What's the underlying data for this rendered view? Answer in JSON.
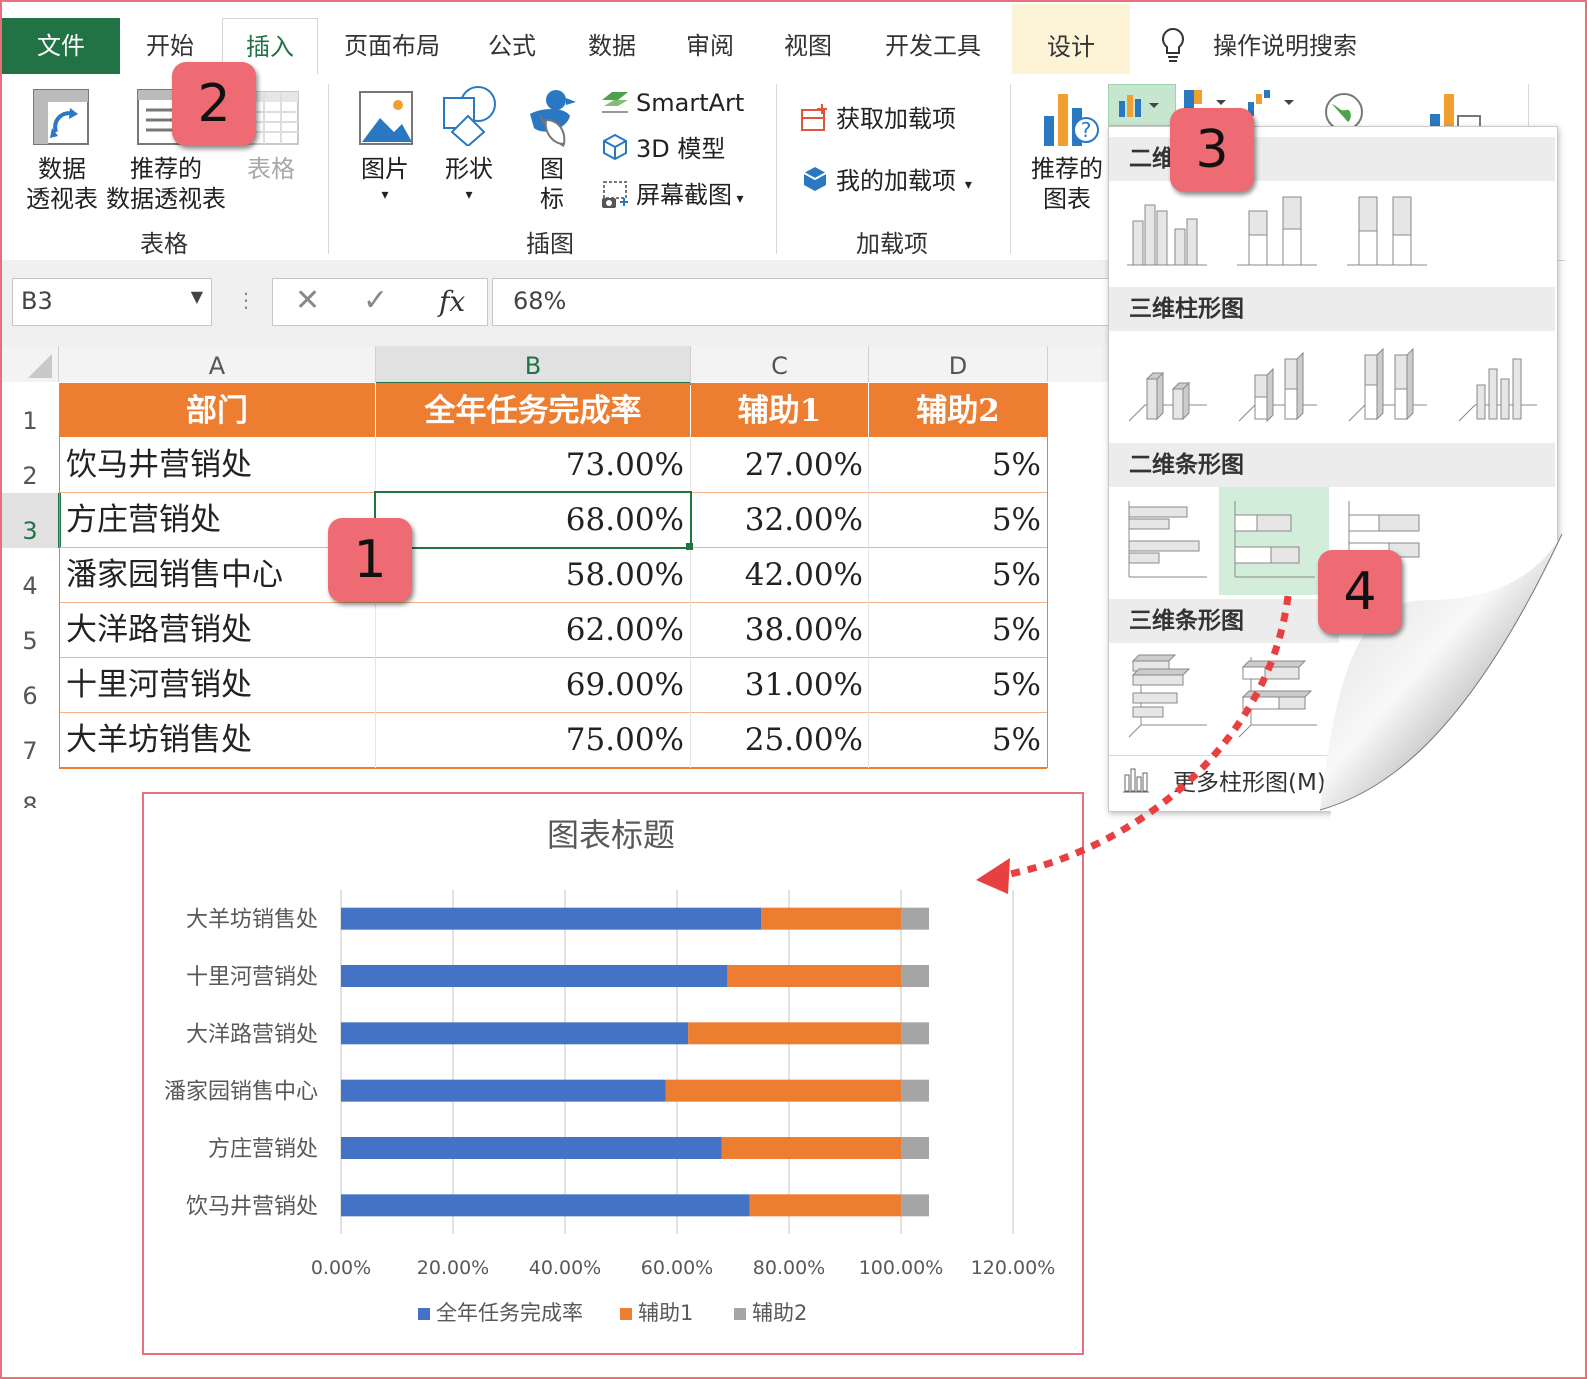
{
  "tabs": [
    {
      "label": "文件",
      "kind": "file"
    },
    {
      "label": "开始"
    },
    {
      "label": "插入",
      "kind": "active"
    },
    {
      "label": "页面布局"
    },
    {
      "label": "公式"
    },
    {
      "label": "数据"
    },
    {
      "label": "审阅"
    },
    {
      "label": "视图"
    },
    {
      "label": "开发工具"
    },
    {
      "label": "设计",
      "kind": "design"
    }
  ],
  "tell_me": "操作说明搜索",
  "ribbon": {
    "pivot_l1": "数据",
    "pivot_l2": "透视表",
    "rec_pivot_l1": "推荐的",
    "rec_pivot_l2": "数据透视表",
    "table": "表格",
    "group_table": "表格",
    "picture": "图片",
    "shapes": "形状",
    "icons_l1": "图",
    "icons_l2": "标",
    "smartart": "SmartArt",
    "model3d": "3D 模型",
    "screenshot": "屏幕截图",
    "group_illustrations": "插图",
    "get_addins": "获取加载项",
    "my_addins": "我的加载项",
    "group_addins": "加载项",
    "rec_chart_l1": "推荐的",
    "rec_chart_l2": "图表"
  },
  "formula_bar": {
    "name_box": "B3",
    "value": "68%",
    "fx": "fx"
  },
  "columns": [
    "A",
    "B",
    "C",
    "D"
  ],
  "rows": [
    "1",
    "2",
    "3",
    "4",
    "5",
    "6",
    "7",
    "8"
  ],
  "table": {
    "headers": [
      "部门",
      "全年任务完成率",
      "辅助1",
      "辅助2"
    ],
    "data": [
      [
        "饮马井营销处",
        "73.00%",
        "27.00%",
        "5%"
      ],
      [
        "方庄营销处",
        "68.00%",
        "32.00%",
        "5%"
      ],
      [
        "潘家园销售中心",
        "58.00%",
        "42.00%",
        "5%"
      ],
      [
        "大洋路营销处",
        "62.00%",
        "38.00%",
        "5%"
      ],
      [
        "十里河营销处",
        "69.00%",
        "31.00%",
        "5%"
      ],
      [
        "大羊坊销售处",
        "75.00%",
        "25.00%",
        "5%"
      ]
    ]
  },
  "dropdown": {
    "sec1": "二维柱形图",
    "sec1_visible": "二维",
    "sec2": "三维柱形图",
    "sec3": "二维条形图",
    "sec4": "三维条形图",
    "more": "更多柱形图(M)..."
  },
  "badges": [
    "1",
    "2",
    "3",
    "4"
  ],
  "colors": {
    "accent_green": "#217346",
    "header_orange": "#ed7d31",
    "blue": "#4472c4",
    "orange": "#ed7d31",
    "gray": "#a5a5a5",
    "badge": "#ef6b73"
  },
  "chart_data": {
    "type": "bar",
    "orientation": "horizontal",
    "stacked": true,
    "title": "图表标题",
    "categories": [
      "饮马井营销处",
      "方庄营销处",
      "潘家园销售中心",
      "大洋路营销处",
      "十里河营销处",
      "大羊坊销售处"
    ],
    "series": [
      {
        "name": "全年任务完成率",
        "values": [
          0.73,
          0.68,
          0.58,
          0.62,
          0.69,
          0.75
        ]
      },
      {
        "name": "辅助1",
        "values": [
          0.27,
          0.32,
          0.42,
          0.38,
          0.31,
          0.25
        ]
      },
      {
        "name": "辅助2",
        "values": [
          0.05,
          0.05,
          0.05,
          0.05,
          0.05,
          0.05
        ]
      }
    ],
    "xticks": [
      "0.00%",
      "20.00%",
      "40.00%",
      "60.00%",
      "80.00%",
      "100.00%",
      "120.00%"
    ],
    "xlim": [
      0,
      1.2
    ],
    "grid": true,
    "legend": "bottom"
  }
}
